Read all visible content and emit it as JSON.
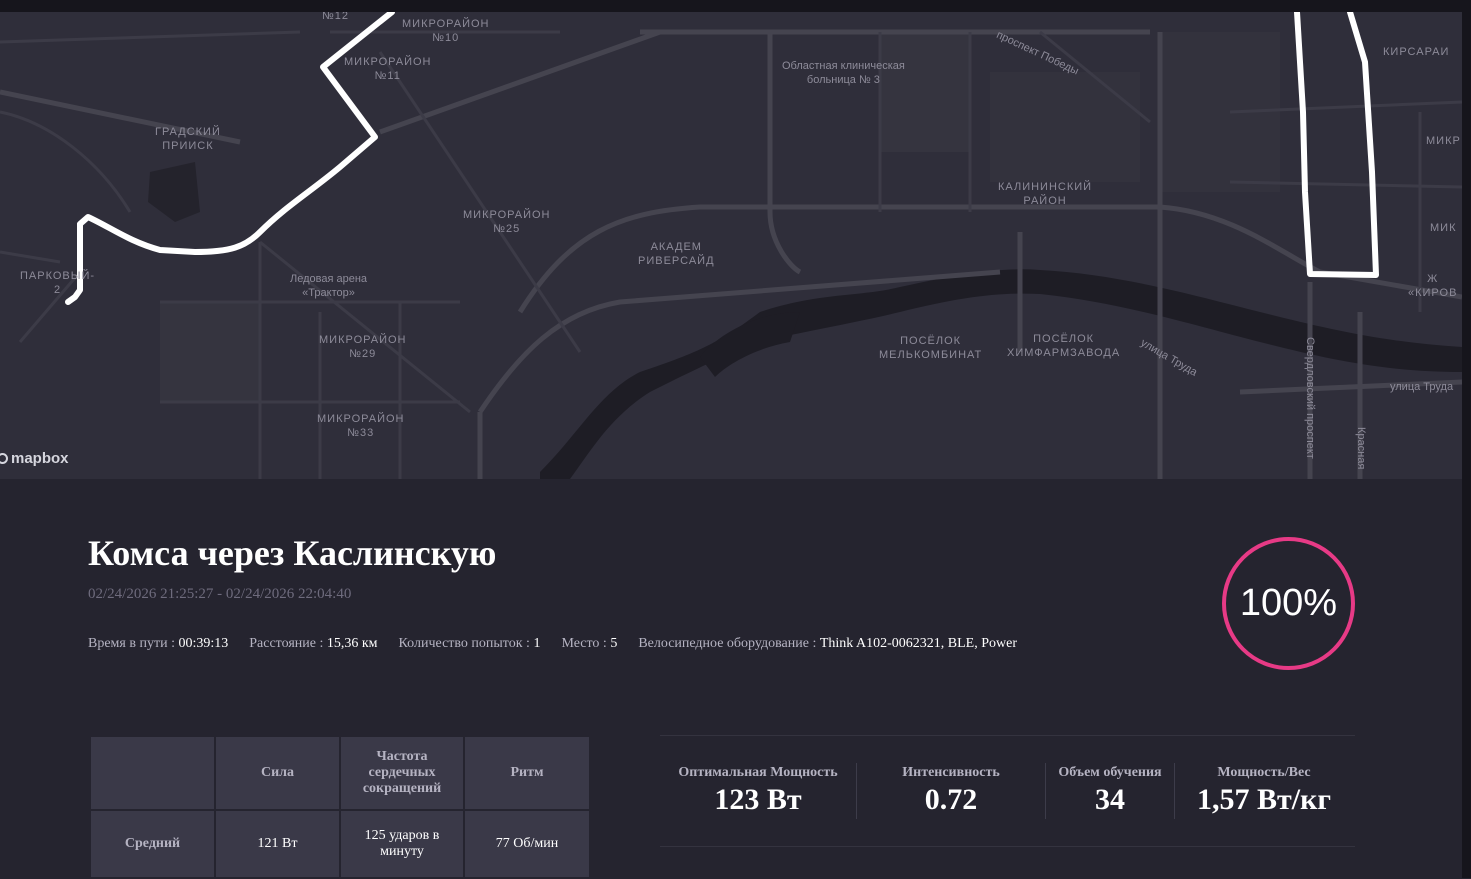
{
  "map": {
    "attribution": "mapbox",
    "labels": [
      {
        "text": "№12",
        "cls": ""
      },
      {
        "text": "МИКРОРАЙОН\n№10",
        "cls": ""
      },
      {
        "text": "МИКРОРАЙОН\n№11",
        "cls": ""
      },
      {
        "text": "проспект Победы",
        "cls": "small"
      },
      {
        "text": "Областная клиническая\nбольница № 3",
        "cls": "small"
      },
      {
        "text": "КИРСАРАИ",
        "cls": ""
      },
      {
        "text": "ГРАДСКИЙ\nПРИИСК",
        "cls": ""
      },
      {
        "text": "МИКР",
        "cls": ""
      },
      {
        "text": "КАЛИНИНСКИЙ\nРАЙОН",
        "cls": ""
      },
      {
        "text": "МИКРОРАЙОН\n№25",
        "cls": ""
      },
      {
        "text": "АКАДЕМ\nРИВЕРСАЙД",
        "cls": ""
      },
      {
        "text": "МИК",
        "cls": ""
      },
      {
        "text": "ПАРКОВЫЙ-\n2",
        "cls": ""
      },
      {
        "text": "Ледовая арена\n«Трактор»",
        "cls": "small"
      },
      {
        "text": "Ж\n«КИРОВ",
        "cls": ""
      },
      {
        "text": "МИКРОРАЙОН\n№29",
        "cls": ""
      },
      {
        "text": "ПОСЁЛОК\nМЕЛЬКОМБИНАТ",
        "cls": ""
      },
      {
        "text": "ПОСЁЛОК\nХИМФАРМЗАВОДА",
        "cls": ""
      },
      {
        "text": "улица Труда",
        "cls": "small"
      },
      {
        "text": "улица Труда",
        "cls": "small"
      },
      {
        "text": "МИКРОРАЙОН\n№33",
        "cls": ""
      },
      {
        "text": "Свердловский проспект",
        "cls": "small"
      },
      {
        "text": "Красная",
        "cls": "small"
      }
    ]
  },
  "activity": {
    "title": "Комса через Каслинскую",
    "dates": "02/24/2026 21:25:27 - 02/24/2026 22:04:40",
    "progress": "100%",
    "meta": [
      {
        "label": "Время в пути : ",
        "value": "00:39:13"
      },
      {
        "label": "Расстояние : ",
        "value": "15,36 км"
      },
      {
        "label": "Количество попыток : ",
        "value": "1"
      },
      {
        "label": "Место : ",
        "value": "5"
      },
      {
        "label": "Велосипедное оборудование : ",
        "value": "Think A102-0062321, BLE, Power"
      }
    ]
  },
  "stats_table": {
    "headers": [
      "",
      "Сила",
      "Частота сердечных сокращений",
      "Ритм"
    ],
    "rows": [
      {
        "label": "Средний",
        "values": [
          "121 Вт",
          "125 ударов в минуту",
          "77 Об/мин"
        ]
      }
    ]
  },
  "metrics": [
    {
      "label": "Оптимальная Мощность",
      "value": "123 Вт"
    },
    {
      "label": "Интенсивность",
      "value": "0.72"
    },
    {
      "label": "Объем обучения",
      "value": "34"
    },
    {
      "label": "Мощность/Вес",
      "value": "1,57 Вт/кг"
    }
  ]
}
